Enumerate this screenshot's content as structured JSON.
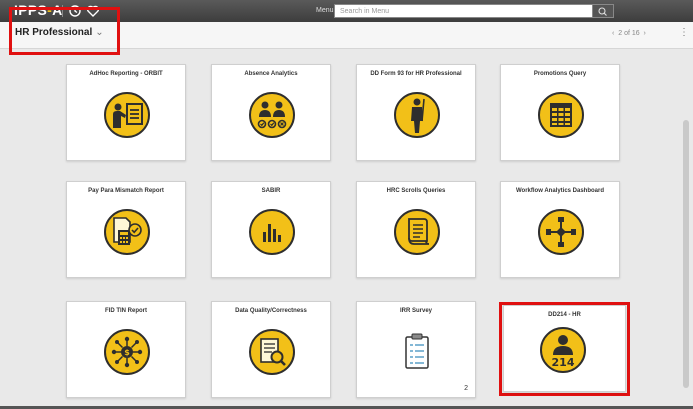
{
  "app": {
    "logo_prefix": "IPPS",
    "logo_suffix": "A"
  },
  "header": {
    "menu_label": "Menu",
    "search_placeholder": "Search in Menu"
  },
  "page": {
    "title": "HR Professional",
    "pager": "2 of 16"
  },
  "tiles": [
    {
      "title": "AdHoc Reporting - ORBIT",
      "icon": "presenter-icon"
    },
    {
      "title": "Absence Analytics",
      "icon": "group-analytics-icon"
    },
    {
      "title": "DD Form 93 for HR Professional",
      "icon": "soldier-icon"
    },
    {
      "title": "Promotions Query",
      "icon": "spreadsheet-icon"
    },
    {
      "title": "Pay Para Mismatch Report",
      "icon": "calculator-document-icon"
    },
    {
      "title": "SABIR",
      "icon": "bar-chart-icon"
    },
    {
      "title": "HRC Scrolls Queries",
      "icon": "scroll-icon"
    },
    {
      "title": "Workflow Analytics Dashboard",
      "icon": "workflow-icon"
    },
    {
      "title": "FID TIN Report",
      "icon": "money-network-icon"
    },
    {
      "title": "Data Quality/Correctness",
      "icon": "document-magnify-icon"
    },
    {
      "title": "IRR Survey",
      "icon": "clipboard-icon",
      "count": "2"
    },
    {
      "title": "DD214 - HR",
      "icon": "person-214-icon",
      "badge": "214"
    }
  ],
  "colors": {
    "topbar": "#3d3d3d",
    "icon_yellow": "#f2c018",
    "icon_dark": "#2e2e2e",
    "highlight": "#e01010"
  }
}
